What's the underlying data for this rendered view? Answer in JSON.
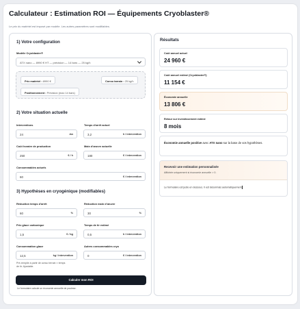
{
  "header": {
    "title": "Calculateur : Estimation ROI — Équipements Cryoblaster®",
    "subtitle": "Le prix du matériel est imposé par modèle. Les autres paramètres sont modifiables."
  },
  "config": {
    "heading": "1) Votre configuration",
    "model_label": "Modèle Cryoblaster®",
    "model_value": "ATX nano — 8990 € HT — précision — 14 bars — 25 kg/h",
    "price_label": "Prix matériel :",
    "price_value": "8990 €",
    "consumption_label": "Conso tarrain :",
    "consumption_value": "25 kg/h",
    "positioning_label": "Positionnement :",
    "positioning_value": "Précision (max 14 bars)"
  },
  "situation": {
    "heading": "2) Votre situation actuelle",
    "interventions_label": "Interventions",
    "interventions_value": "24",
    "interventions_unit": "/an",
    "time_label": "Temps d'arrêt actuel",
    "time_value": "3,2",
    "time_unit": "h / intervention",
    "cost_label": "Coût horaire de production",
    "cost_value": "250",
    "cost_unit": "€ / h",
    "labour_label": "Main d'œuvre actuelle",
    "labour_value": "180",
    "labour_unit": "€ / intervention",
    "consumables_label": "Consommables actuels",
    "consumables_value": "60",
    "consumables_unit": "€ / intervention"
  },
  "hypotheses": {
    "heading": "3) Hypothèses en cryogénique (modifiables)",
    "reduction_time_label": "Réduction temps d'arrêt",
    "reduction_time_value": "60",
    "reduction_time_unit": "%",
    "reduction_labour_label": "Réduction main d'œuvre",
    "reduction_labour_value": "30",
    "reduction_labour_unit": "%",
    "ice_price_label": "Prix glace carbonique",
    "ice_price_value": "1,5",
    "ice_price_unit": "€ / kg",
    "blast_time_label": "Temps de tir estimé",
    "blast_time_value": "0,5",
    "blast_time_unit": "h / intervention",
    "ice_consumption_label": "Consommation glace",
    "ice_consumption_value": "12,5",
    "ice_consumption_unit": "kg / intervention",
    "other_label": "Autres consommables cryo",
    "other_value": "0",
    "other_unit": "€ / intervention",
    "hint_line1": "Pré-remplie à partir de conso terrain × temps",
    "hint_line2": "de tir. Ajustable."
  },
  "actions": {
    "calculate_label": "Calculer mon ROI",
    "footnote": "Le formulaire calcule un économie annuelle de poulese."
  },
  "results": {
    "heading": "Résultats",
    "current_cost_label": "Coût annuel actuel",
    "current_cost_value": "24 960 €",
    "estimated_cost_label": "Coût annuel estimé (Cryoblaster®)",
    "estimated_cost_value": "11 154 €",
    "savings_label": "Économie annuelle",
    "savings_value": "13 806 €",
    "payback_label": "Retour sur investissement estimé",
    "payback_value": "8 mois",
    "note_bold1": "Économie annuelle positive",
    "note_text1": " avec ",
    "note_bold2": "ATX nano",
    "note_text2": " sur la base de vos hypothèses.",
    "cta_title": "Recevoir une estimation personnalisée",
    "cta_subtitle": "Affichée uniquement si économie annuelle > 0.",
    "cta_body": "Le formulaire est juste en dessous. Il est désormais automatiquement"
  },
  "colors": {
    "primary_button": "#141b26",
    "savings_bg": "#fdf3e8",
    "page_bg": "#eceef2"
  },
  "icons": {
    "model_select": "chevron-down-icon"
  }
}
